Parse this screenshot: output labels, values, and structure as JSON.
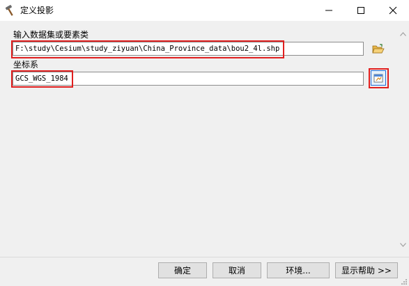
{
  "window": {
    "title": "定义投影"
  },
  "fields": {
    "input_dataset": {
      "label": "输入数据集或要素类",
      "value": "F:\\study\\Cesium\\study_ziyuan\\China_Province_data\\bou2_4l.shp"
    },
    "coordinate_system": {
      "label": "坐标系",
      "value": "GCS_WGS_1984"
    }
  },
  "footer": {
    "ok": "确定",
    "cancel": "取消",
    "environments": "环境...",
    "show_help": "显示帮助 >>"
  },
  "colors": {
    "highlight": "#e01f1f",
    "focus": "#1f6ad6"
  }
}
